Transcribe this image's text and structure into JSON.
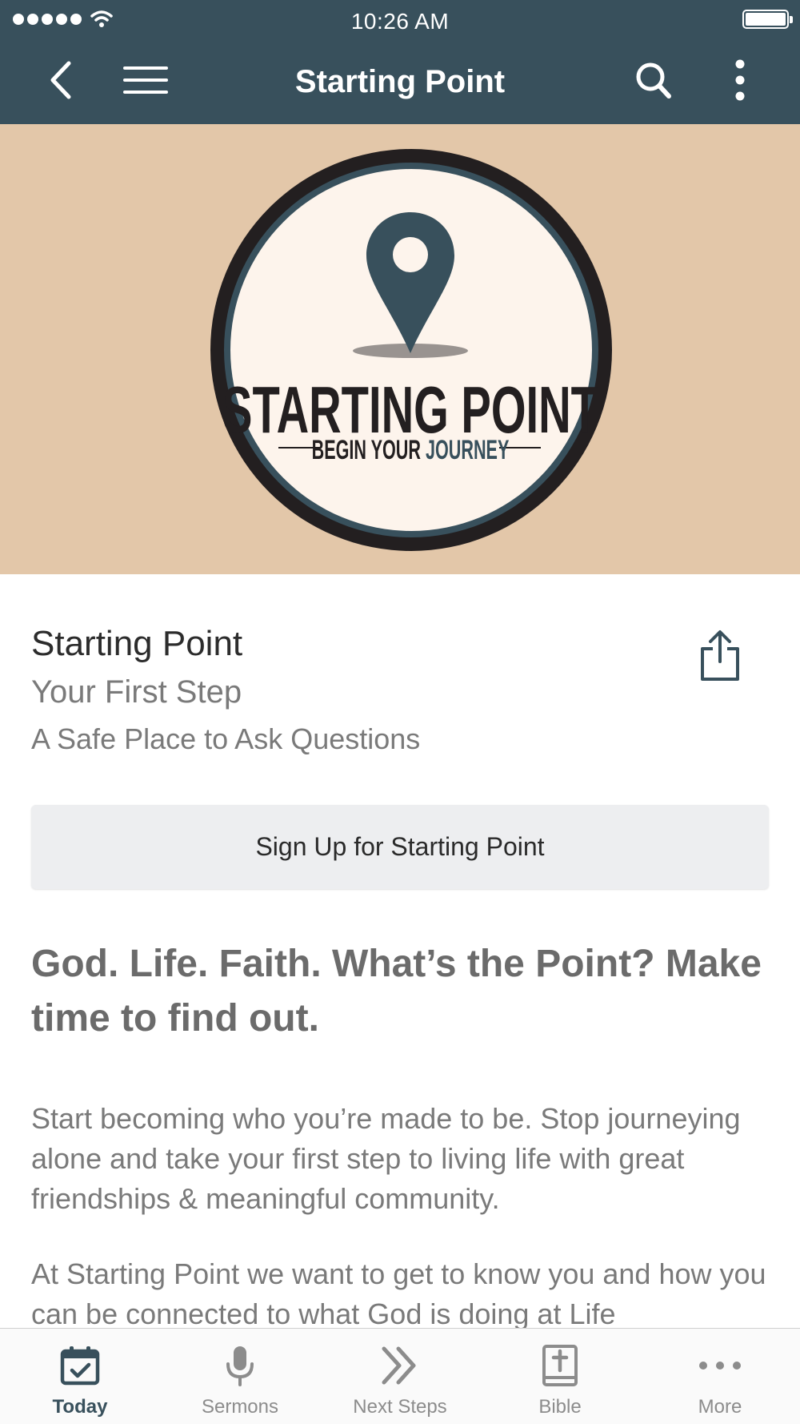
{
  "status_bar": {
    "time": "10:26 AM"
  },
  "nav": {
    "title": "Starting Point"
  },
  "hero": {
    "logo_title": "STARTING POINT",
    "logo_subtitle_prefix": "BEGIN YOUR ",
    "logo_subtitle_accent": "JOURNEY",
    "background_color": "#e3c7a9",
    "pin_color": "#38505c"
  },
  "content": {
    "title": "Starting Point",
    "subtitle": "Your First Step",
    "tagline": "A Safe Place to Ask Questions",
    "signup_label": "Sign Up for Starting Point",
    "headline": "God. Life. Faith. What’s the Point? Make time to find out.",
    "paragraph1": "Start becoming who you’re made to be. Stop journeying alone and take your first step to living life with great friendships & meaningful community.",
    "paragraph2": "At Starting Point we want to get to know you and how you can be connected to what God is doing at Life"
  },
  "tabs": [
    {
      "label": "Today",
      "icon": "calendar-check-icon",
      "active": true
    },
    {
      "label": "Sermons",
      "icon": "microphone-icon",
      "active": false
    },
    {
      "label": "Next Steps",
      "icon": "double-chevron-icon",
      "active": false
    },
    {
      "label": "Bible",
      "icon": "bible-icon",
      "active": false
    },
    {
      "label": "More",
      "icon": "more-dots-icon",
      "active": false
    }
  ],
  "colors": {
    "nav_bar": "#38505c",
    "accent": "#38505c"
  }
}
